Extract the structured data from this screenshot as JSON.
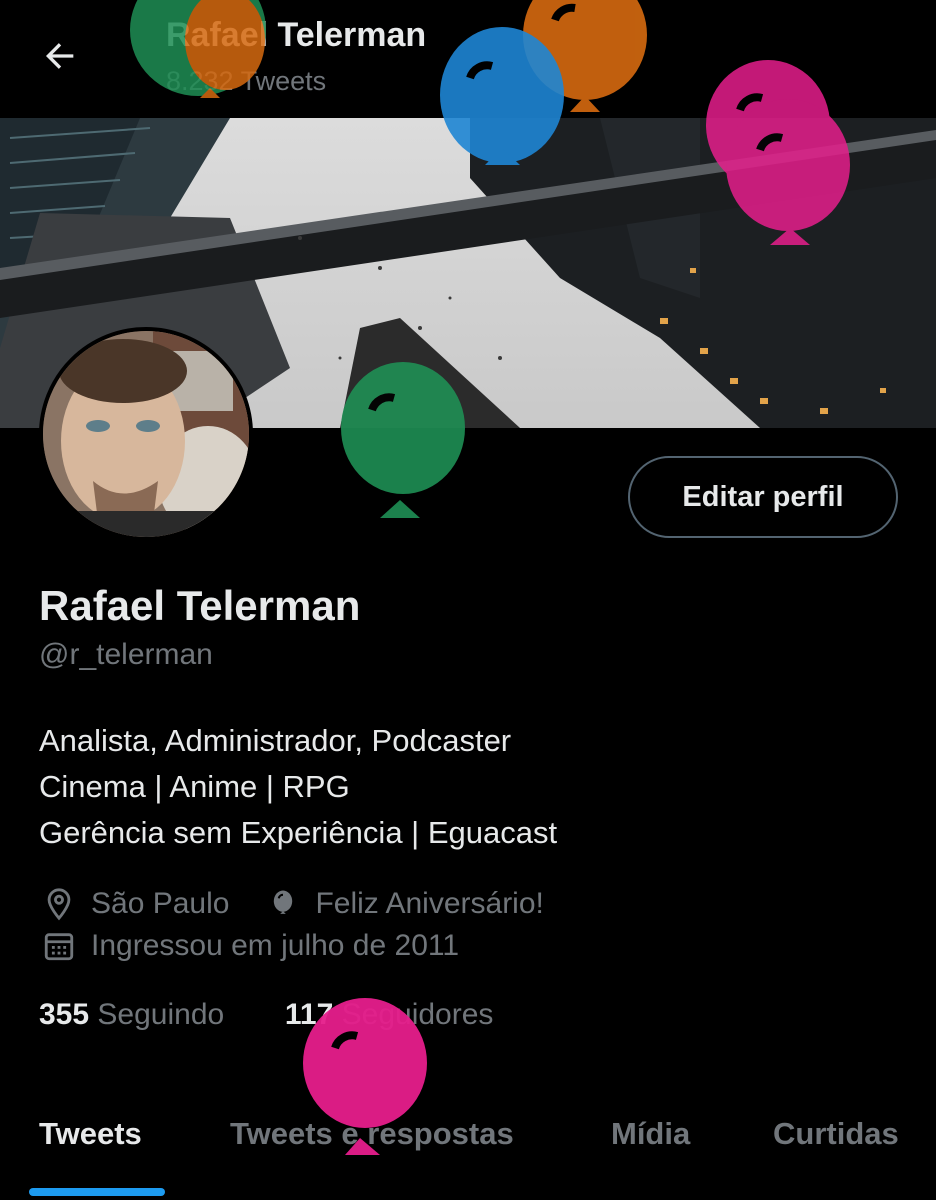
{
  "header": {
    "back_label": "back",
    "title": "Rafael Telerman",
    "tweet_count": "8.232 Tweets"
  },
  "profile": {
    "edit_button": "Editar perfil",
    "display_name": "Rafael Telerman",
    "handle": "@r_telerman",
    "bio": [
      "Analista, Administrador, Podcaster",
      "Cinema | Anime | RPG",
      "Gerência sem Experiência | Eguacast"
    ],
    "location": "São Paulo",
    "birthday": "Feliz Aniversário!",
    "joined": "Ingressou em julho de 2011",
    "following_count": "355",
    "following_label": "Seguindo",
    "followers_count": "117",
    "followers_label": "Seguidores"
  },
  "tabs": [
    {
      "label": "Tweets",
      "active": true
    },
    {
      "label": "Tweets e respostas",
      "active": false
    },
    {
      "label": "Mídia",
      "active": false
    },
    {
      "label": "Curtidas",
      "active": false
    }
  ],
  "icons": {
    "back": "arrow-left-icon",
    "location": "map-pin-icon",
    "birthday": "balloon-icon",
    "joined": "calendar-icon"
  },
  "colors": {
    "background": "#000000",
    "text_primary": "#e7e9ea",
    "text_secondary": "#71767b",
    "accent": "#1d9bf0",
    "balloon_green": "#1f8f55",
    "balloon_orange": "#d66a10",
    "balloon_blue": "#1f86d4",
    "balloon_pink": "#e61e8c"
  }
}
